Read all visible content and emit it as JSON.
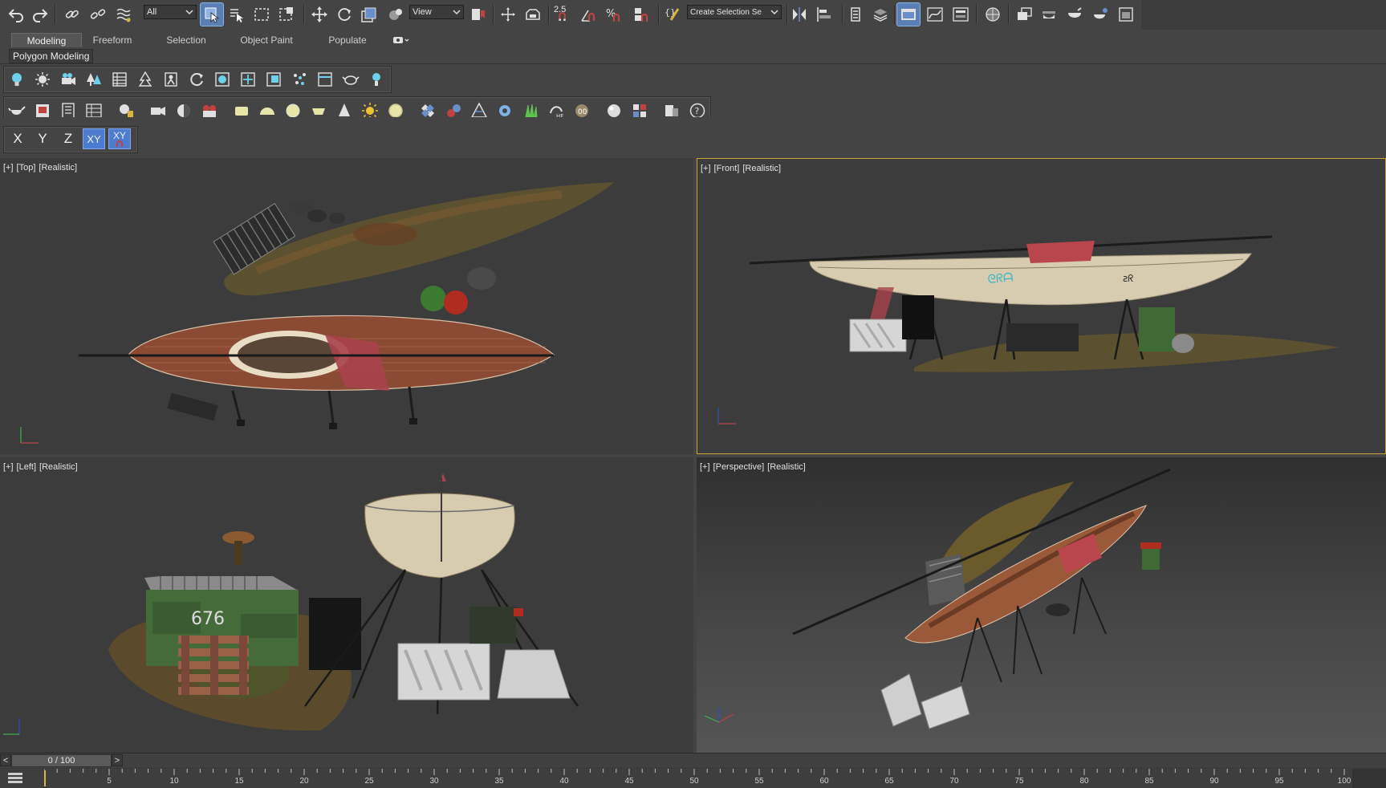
{
  "toolbar": {
    "selection_filter": "All",
    "reference_coord": "View",
    "snap_label": "2.5",
    "named_selection_placeholder": "Create Selection Se",
    "icons": [
      "undo-icon",
      "redo-icon",
      "link-icon",
      "unlink-icon",
      "bind-space-warp-icon",
      "select-object-icon",
      "select-by-name-icon",
      "rect-selection-icon",
      "window-crossing-icon",
      "move-icon",
      "rotate-icon",
      "scale-icon",
      "pivot-icon",
      "keyboard-shortcut-icon",
      "snaps-toggle-icon",
      "angle-snap-icon",
      "percent-snap-icon",
      "spinner-snap-icon",
      "edit-named-selections-icon",
      "mirror-icon",
      "align-icon",
      "layer-explorer-icon",
      "scene-explorer-icon",
      "curve-editor-icon",
      "schematic-view-icon",
      "material-editor-icon",
      "render-setup-icon",
      "rendered-frame-window-icon",
      "render-production-icon",
      "render-iterative-icon",
      "a360-render-icon"
    ]
  },
  "ribbon": {
    "tabs": [
      {
        "label": "Modeling",
        "active": true
      },
      {
        "label": "Freeform"
      },
      {
        "label": "Selection"
      },
      {
        "label": "Object Paint"
      },
      {
        "label": "Populate"
      }
    ],
    "panel_label": "Polygon Modeling"
  },
  "axis_constraints": {
    "x": "X",
    "y": "Y",
    "z": "Z",
    "xy": "XY",
    "xy_snap": "XY"
  },
  "viewports": [
    {
      "id": "top",
      "plus": "[+]",
      "view": "[Top]",
      "shading": "[Realistic]"
    },
    {
      "id": "front",
      "plus": "[+]",
      "view": "[Front]",
      "shading": "[Realistic]",
      "active": true
    },
    {
      "id": "left",
      "plus": "[+]",
      "view": "[Left]",
      "shading": "[Realistic]"
    },
    {
      "id": "perspective",
      "plus": "[+]",
      "view": "[Perspective]",
      "shading": "[Realistic]"
    }
  ],
  "scene_objects": [
    "container-676"
  ],
  "dumpster_text": "676",
  "timeline": {
    "frame_display": "0 / 100",
    "prev": "<",
    "next": ">",
    "ticks": [
      "5",
      "10",
      "15",
      "20",
      "25",
      "30",
      "35",
      "40",
      "45",
      "50",
      "55",
      "60",
      "65",
      "70",
      "75",
      "80",
      "85",
      "90",
      "95",
      "100"
    ]
  },
  "colors": {
    "active_viewport_border": "#c8a23a",
    "active_button": "#4d7bd0",
    "ui_background": "#444444"
  }
}
